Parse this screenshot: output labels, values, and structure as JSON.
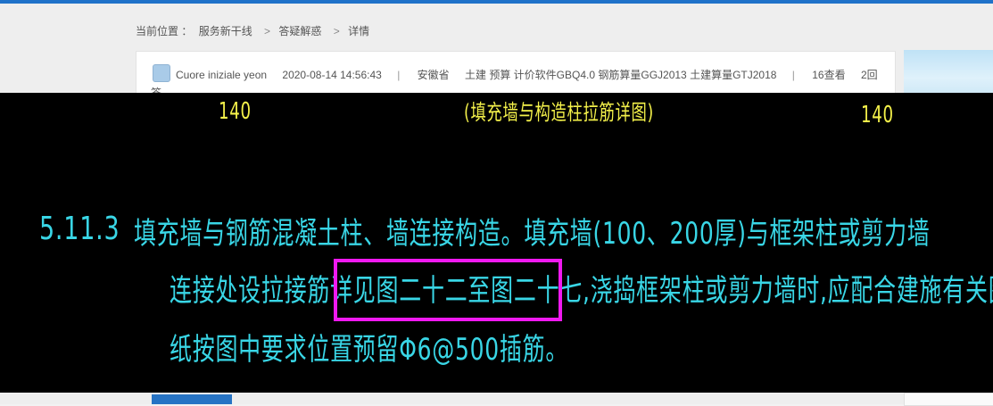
{
  "breadcrumb": {
    "prefix": "当前位置 ：",
    "items": [
      "服务新干线",
      "答疑解惑",
      "详情"
    ],
    "sep": ">"
  },
  "post": {
    "author": "Cuore iniziale yeon",
    "datetime": "2020-08-14 14:56:43",
    "region": "安徽省",
    "tags": "土建 预算 计价软件GBQ4.0 钢筋算量GGJ2013 土建算量GTJ2018",
    "views": "16查看",
    "answers": "2回",
    "answers_cut": "答"
  },
  "cad": {
    "dim_left": "140",
    "dim_title": "(填充墙与构造柱拉筋详图)",
    "dim_right": "140",
    "section_number": "5.11.3",
    "line1": "填充墙与钢筋混凝土柱、墙连接构造。填充墙(100、200厚)与框架柱或剪力墙",
    "line2": "连接处设拉接筋详见图二十二至图二十七,浇捣框架柱或剪力墙时,应配合建施有关图",
    "line3": "纸按图中要求位置预留Φ6@500插筋。"
  },
  "colors": {
    "cad_bg": "#000000",
    "cad_yellow": "#f4f14a",
    "cad_cyan": "#39d6e6",
    "highlight": "#f019f0",
    "brand_blue": "#1f72c9"
  }
}
